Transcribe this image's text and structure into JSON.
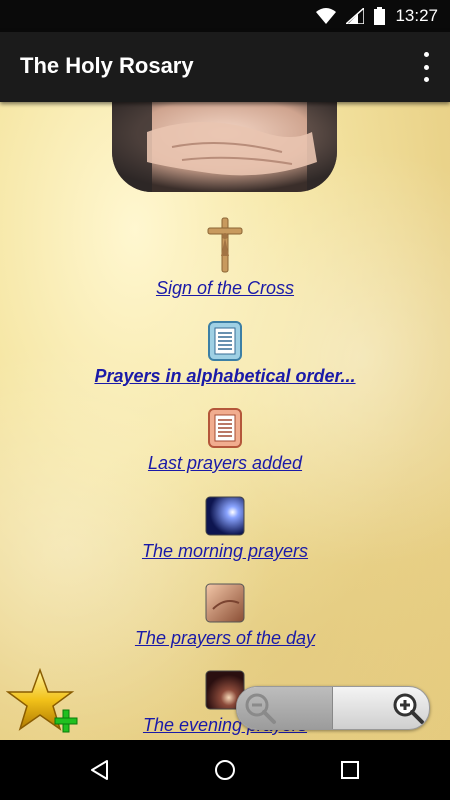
{
  "status_bar": {
    "time": "13:27"
  },
  "app_bar": {
    "title": "The Holy Rosary"
  },
  "menu": [
    {
      "label": "Sign of the Cross",
      "icon": "crucifix-icon",
      "bold": false
    },
    {
      "label": "Prayers in alphabetical order...",
      "icon": "blue-document-icon",
      "bold": true
    },
    {
      "label": "Last prayers added",
      "icon": "red-document-icon",
      "bold": false
    },
    {
      "label": "The morning prayers",
      "icon": "morning-light-icon",
      "bold": false
    },
    {
      "label": "The prayers of the day",
      "icon": "praying-face-icon",
      "bold": false
    },
    {
      "label": "The evening prayers",
      "icon": "evening-candle-icon",
      "bold": false
    }
  ],
  "colors": {
    "link": "#1a1aa8",
    "app_bar": "#1b1b1b",
    "background": "#f6e7a6"
  }
}
